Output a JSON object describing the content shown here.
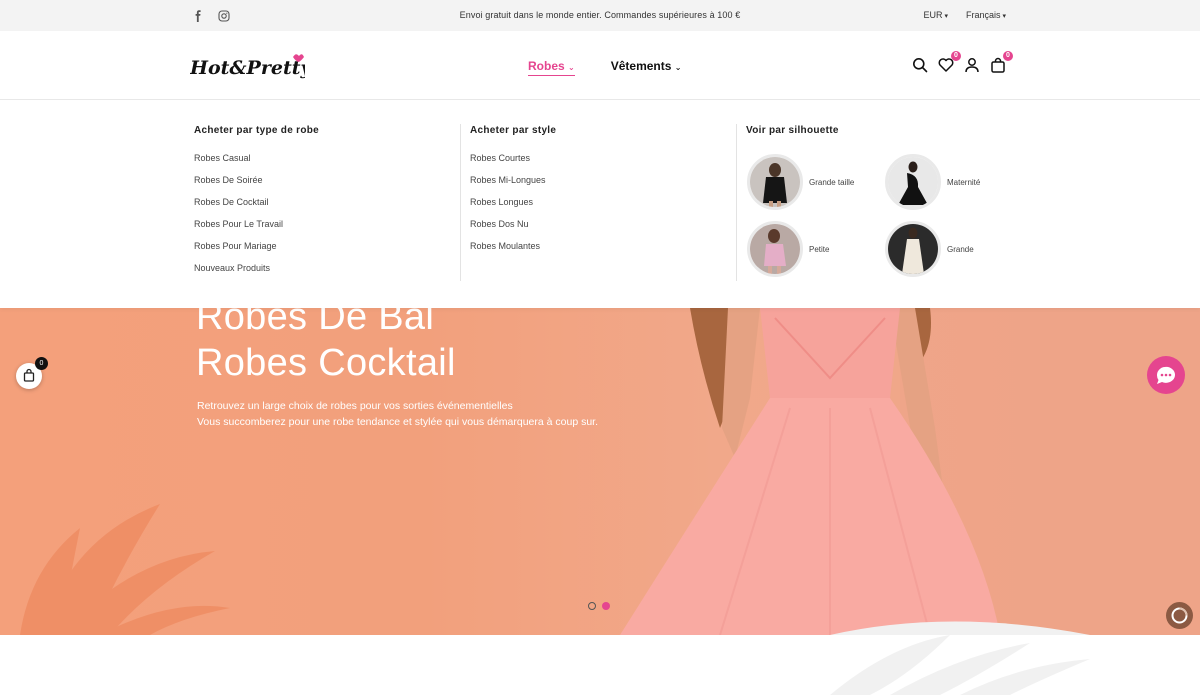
{
  "topbar": {
    "announcement": "Envoi gratuit dans le monde entier. Commandes supérieures à 100 €",
    "currency": "EUR",
    "language": "Français",
    "social": [
      "facebook-icon",
      "instagram-icon"
    ]
  },
  "header": {
    "logo_text": "Hot&Pretty",
    "nav": [
      {
        "label": "Robes",
        "active": true
      },
      {
        "label": "Vêtements",
        "active": false
      }
    ],
    "wishlist_count": "0",
    "cart_count": "0"
  },
  "mega_menu": {
    "col1": {
      "title": "Acheter par type de robe",
      "items": [
        "Robes Casual",
        "Robes De Soirée",
        "Robes De Cocktail",
        "Robes Pour Le Travail",
        "Robes Pour Mariage",
        "Nouveaux Produits"
      ]
    },
    "col2": {
      "title": "Acheter par style",
      "items": [
        "Robes Courtes",
        "Robes Mi-Longues",
        "Robes Longues",
        "Robes Dos Nu",
        "Robes Moulantes"
      ]
    },
    "col3": {
      "title": "Voir par silhouette",
      "items": [
        "Grande taille",
        "Maternité",
        "Petite",
        "Grande"
      ]
    }
  },
  "hero": {
    "line1": "Robes De Bal",
    "line2": "Robes Cocktail",
    "sub1": "Retrouvez un large choix de robes pour vos sorties événementielles",
    "sub2": "Vous succomberez pour une robe tendance et stylée qui vous démarquera à coup sur."
  },
  "floating_cart_count": "0",
  "colors": {
    "accent": "#e5458f",
    "hero_bg": "#f4a07b"
  }
}
